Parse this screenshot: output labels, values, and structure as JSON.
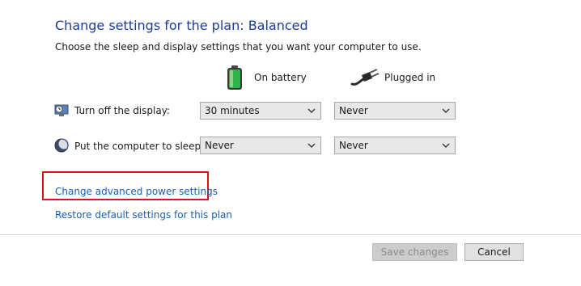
{
  "header": {
    "title": "Change settings for the plan: Balanced",
    "subtitle": "Choose the sleep and display settings that you want your computer to use."
  },
  "columns": {
    "battery": {
      "label": "On battery",
      "icon": "battery-icon"
    },
    "plugged": {
      "label": "Plugged in",
      "icon": "power-plug-icon"
    }
  },
  "settings": [
    {
      "label": "Turn off the display:",
      "icon": "display-clock-icon",
      "battery_value": "30 minutes",
      "plugged_value": "Never"
    },
    {
      "label": "Put the computer to sleep:",
      "icon": "moon-sleep-icon",
      "battery_value": "Never",
      "plugged_value": "Never"
    }
  ],
  "links": {
    "advanced": "Change advanced power settings",
    "restore": "Restore default settings for this plan"
  },
  "buttons": {
    "save": "Save changes",
    "cancel": "Cancel"
  },
  "colors": {
    "title": "#1e3c96",
    "link": "#1a5fb4",
    "highlight": "#e0101a"
  }
}
